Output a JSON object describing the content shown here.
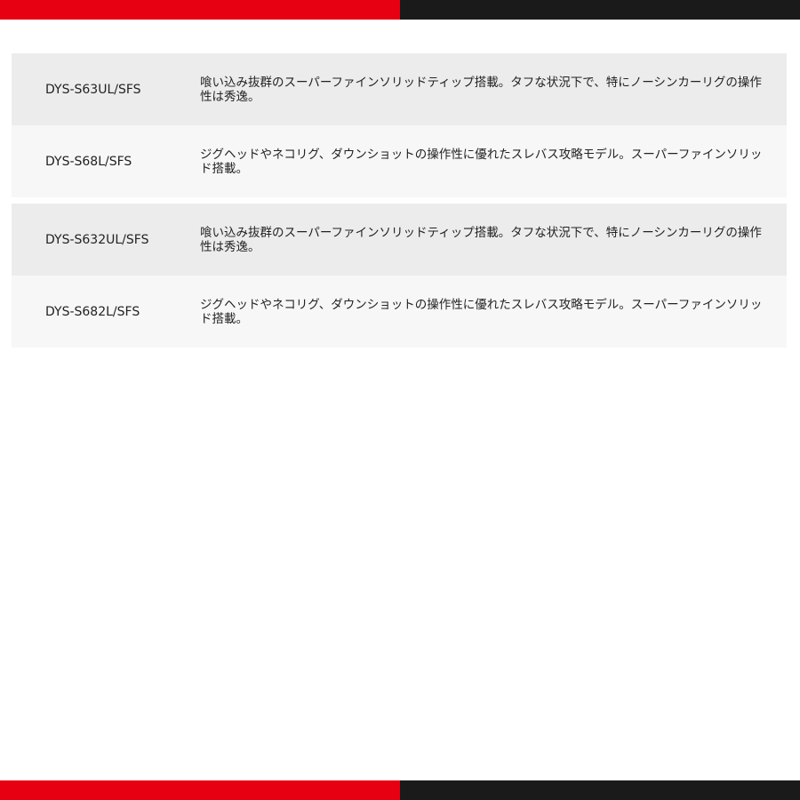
{
  "colors": {
    "accent_red": "#e60012",
    "accent_black": "#1a1a1a",
    "row_dark": "#ececec",
    "row_light": "#f7f7f7"
  },
  "rows": [
    {
      "model": "DYS-S63UL/SFS",
      "description": "喰い込み抜群のスーパーファインソリッドティップ搭載。タフな状況下で、特にノーシンカーリグの操作性は秀逸。"
    },
    {
      "model": "DYS-S68L/SFS",
      "description": "ジグヘッドやネコリグ、ダウンショットの操作性に優れたスレバス攻略モデル。スーパーファインソリッド搭載。"
    },
    {
      "model": "DYS-S632UL/SFS",
      "description": "喰い込み抜群のスーパーファインソリッドティップ搭載。タフな状況下で、特にノーシンカーリグの操作性は秀逸。"
    },
    {
      "model": "DYS-S682L/SFS",
      "description": "ジグヘッドやネコリグ、ダウンショットの操作性に優れたスレバス攻略モデル。スーパーファインソリッド搭載。"
    }
  ]
}
